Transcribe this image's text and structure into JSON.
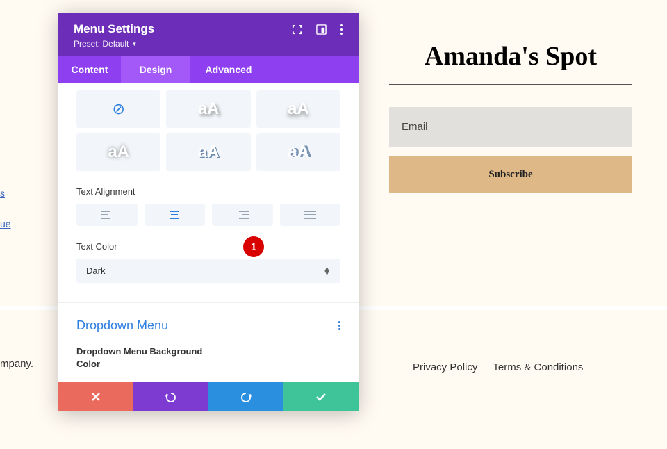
{
  "bg": {
    "title": "Amanda's Spot",
    "email_placeholder": "Email",
    "subscribe": "Subscribe",
    "link1": "s",
    "link2": "ue",
    "company": "mpany.",
    "footer_links": [
      "Privacy Policy",
      "Terms & Conditions"
    ]
  },
  "panel": {
    "title": "Menu Settings",
    "preset": "Preset: Default",
    "tabs": {
      "content": "Content",
      "design": "Design",
      "advanced": "Advanced"
    },
    "text_alignment_label": "Text Alignment",
    "text_color_label": "Text Color",
    "text_color_value": "Dark",
    "dropdown_title": "Dropdown Menu",
    "dropdown_bg_label": "Dropdown Menu Background Color",
    "badge": "1",
    "styles": [
      "aA",
      "aA",
      "aA",
      "aA",
      "aA"
    ]
  }
}
